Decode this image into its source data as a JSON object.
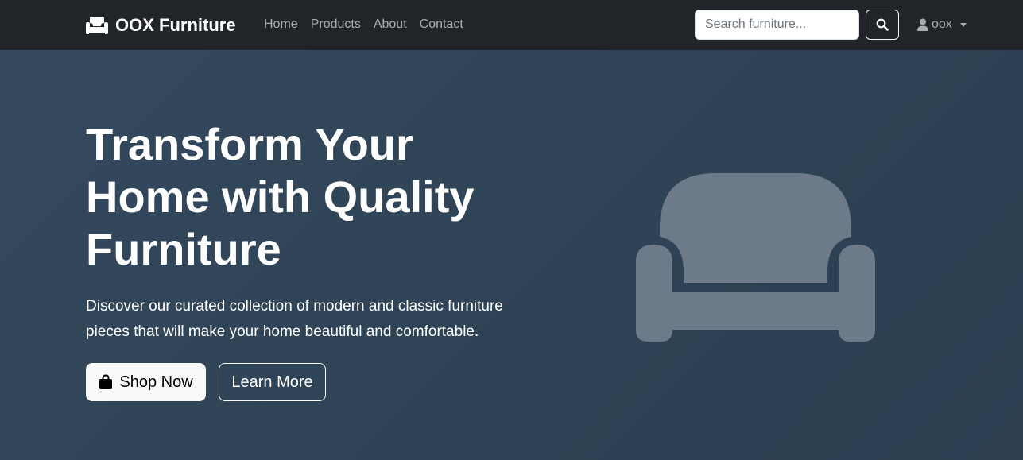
{
  "navbar": {
    "brand": {
      "name": "OOX Furniture",
      "icon": "couch-icon"
    },
    "links": [
      {
        "label": "Home"
      },
      {
        "label": "Products"
      },
      {
        "label": "About"
      },
      {
        "label": "Contact"
      }
    ],
    "search": {
      "placeholder": "Search furniture...",
      "value": "",
      "button_icon": "search-icon"
    },
    "user": {
      "name": "oox",
      "icon": "user-icon"
    }
  },
  "hero": {
    "title": "Transform Your Home with Quality Furniture",
    "lead": "Discover our curated collection of modern and classic furniture pieces that will make your home beautiful and comfortable.",
    "primary_button": {
      "label": "Shop Now",
      "icon": "shopping-bag-icon"
    },
    "secondary_button": {
      "label": "Learn More"
    },
    "illustration": "couch-icon"
  },
  "colors": {
    "navbar_bg": "#212529",
    "hero_bg_start": "#34495e",
    "hero_bg_end": "#2c3e50",
    "illustration": "#6c7a89",
    "text_light": "#ffffff"
  }
}
